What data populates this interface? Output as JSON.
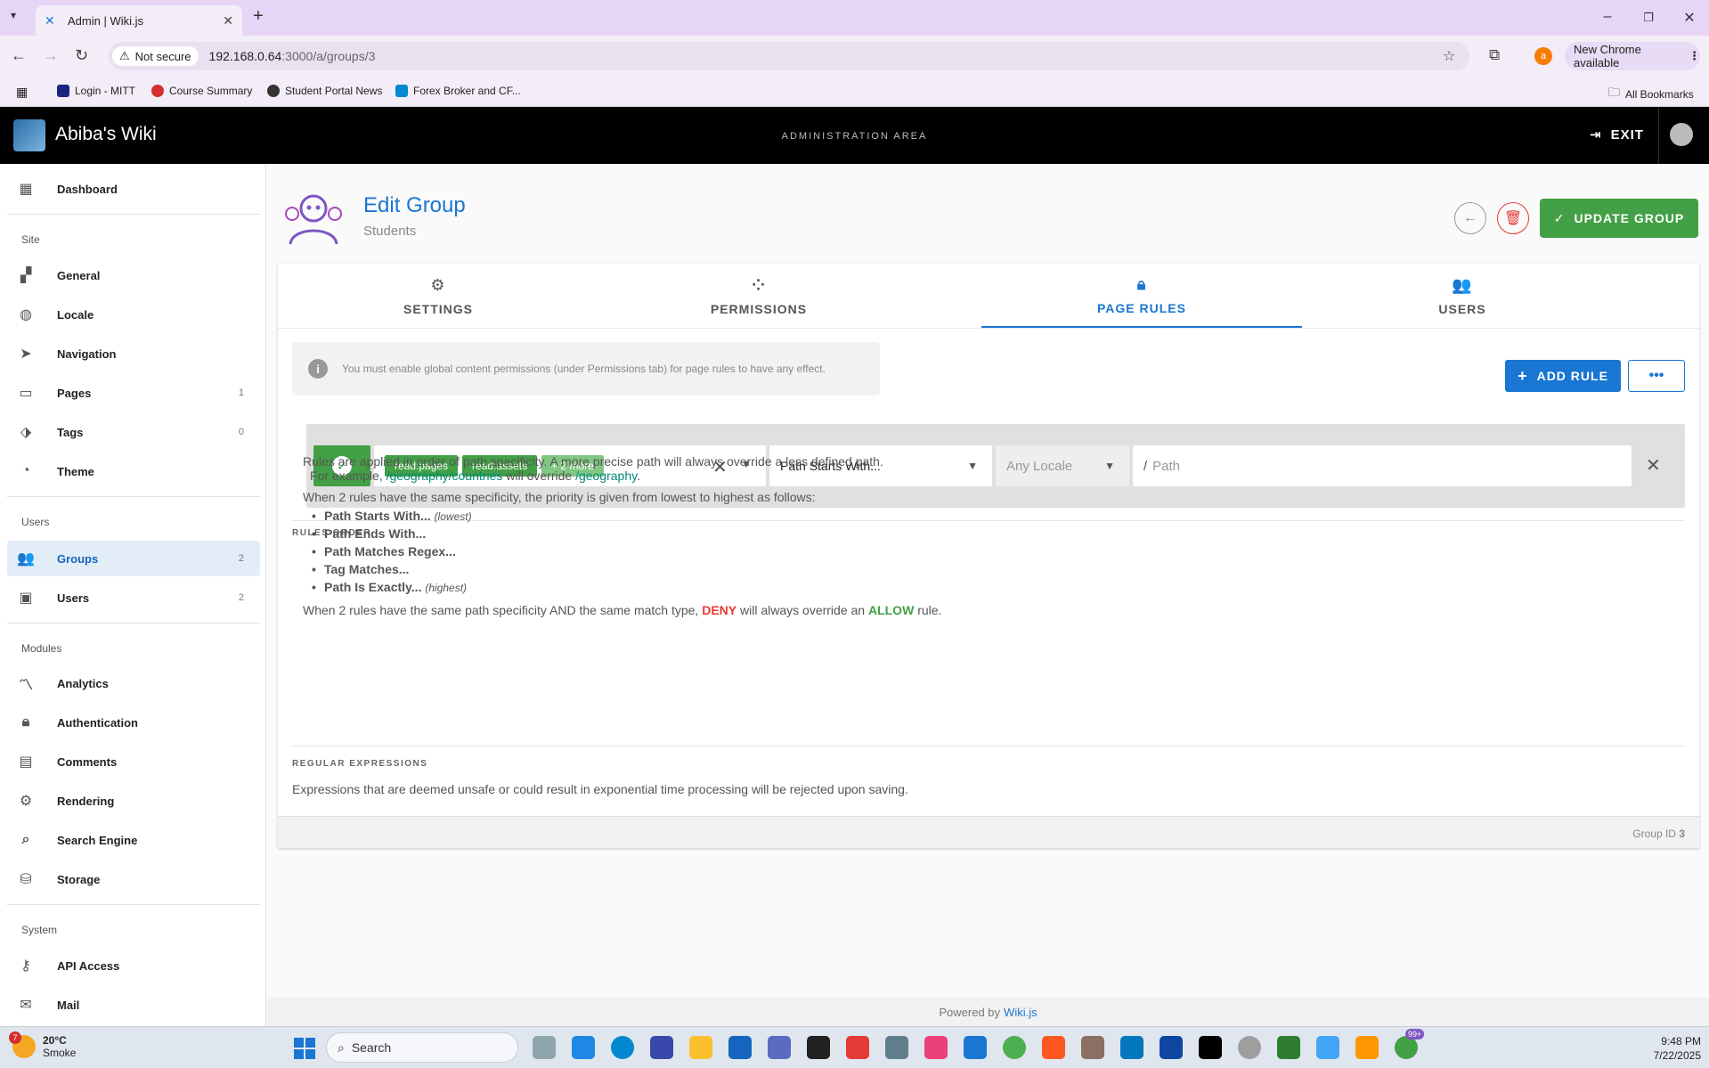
{
  "browser": {
    "tab_title": "Admin | Wiki.js",
    "security_label": "Not secure",
    "url_host": "192.168.0.64",
    "url_path": ":3000/a/groups/3",
    "new_chrome_label": "New Chrome available",
    "profile_initial": "a",
    "bookmarks": [
      {
        "label": "Login - MITT"
      },
      {
        "label": "Course Summary"
      },
      {
        "label": "Student Portal News"
      },
      {
        "label": "Forex Broker and CF..."
      }
    ],
    "all_bookmarks_label": "All Bookmarks"
  },
  "header": {
    "site_title": "Abiba's Wiki",
    "area_label": "ADMINISTRATION AREA",
    "exit_label": "EXIT"
  },
  "sidebar": {
    "dashboard": "Dashboard",
    "sections": {
      "site": "Site",
      "users": "Users",
      "modules": "Modules",
      "system": "System"
    },
    "site_items": [
      {
        "label": "General"
      },
      {
        "label": "Locale"
      },
      {
        "label": "Navigation"
      },
      {
        "label": "Pages",
        "count": "1"
      },
      {
        "label": "Tags",
        "count": "0"
      },
      {
        "label": "Theme"
      }
    ],
    "user_items": [
      {
        "label": "Groups",
        "count": "2"
      },
      {
        "label": "Users",
        "count": "2"
      }
    ],
    "module_items": [
      {
        "label": "Analytics"
      },
      {
        "label": "Authentication"
      },
      {
        "label": "Comments"
      },
      {
        "label": "Rendering"
      },
      {
        "label": "Search Engine"
      },
      {
        "label": "Storage"
      }
    ],
    "system_items": [
      {
        "label": "API Access"
      },
      {
        "label": "Mail"
      }
    ]
  },
  "page": {
    "title": "Edit Group",
    "subtitle": "Students",
    "update_label": "UPDATE GROUP"
  },
  "tabs": [
    {
      "label": "SETTINGS"
    },
    {
      "label": "PERMISSIONS"
    },
    {
      "label": "PAGE RULES"
    },
    {
      "label": "USERS"
    }
  ],
  "rules": {
    "info_text": "You must enable global content permissions (under Permissions tab) for page rules to have any effect.",
    "add_rule_label": "ADD RULE",
    "more_label": "•••",
    "rule": {
      "chips": [
        "read:pages",
        "read:assets",
        "+ 2 more"
      ],
      "match": "Path Starts With...",
      "locale_placeholder": "Any Locale",
      "path_prefix": "/",
      "path_placeholder": "Path"
    }
  },
  "help": {
    "order_heading": "RULES ORDER",
    "p1": "Rules are applied in order of path specificity. A more precise path will always override a less defined path.",
    "p2_pre": "For example,",
    "p2_link1": "/geography/countries",
    "p2_mid": "will override",
    "p2_link2": "/geography",
    "p2_post": ".",
    "p3": "When 2 rules have the same specificity, the priority is given from lowest to highest as follows:",
    "list": [
      {
        "label": "Path Starts With...",
        "note": "(lowest)"
      },
      {
        "label": "Path Ends With...",
        "note": ""
      },
      {
        "label": "Path Matches Regex...",
        "note": ""
      },
      {
        "label": "Tag Matches...",
        "note": ""
      },
      {
        "label": "Path Is Exactly...",
        "note": "(highest)"
      }
    ],
    "p4_pre": "When 2 rules have the same path specificity AND the same match type,",
    "p4_deny": "DENY",
    "p4_mid": "will always override an",
    "p4_allow": "ALLOW",
    "p4_post": "rule.",
    "regex_heading": "REGULAR EXPRESSIONS",
    "regex_text": "Expressions that are deemed unsafe or could result in exponential time processing will be rejected upon saving.",
    "group_id_label": "Group ID",
    "group_id_value": "3"
  },
  "footer": {
    "powered_by": "Powered by",
    "link": "Wiki.js"
  },
  "taskbar": {
    "weather_temp": "20°C",
    "weather_desc": "Smoke",
    "weather_badge": "7",
    "search_label": "Search",
    "notif_badge": "99+",
    "time": "9:48 PM",
    "date": "7/22/2025"
  },
  "colors": {
    "primary": "#1976d2",
    "success": "#43a047",
    "danger": "#e53935",
    "teal": "#00897b"
  }
}
